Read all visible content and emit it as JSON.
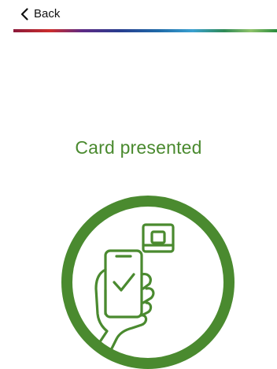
{
  "header": {
    "back_label": "Back",
    "back_icon": "chevron-left-icon"
  },
  "brand_strip": {
    "colors": [
      "#8c1a3a",
      "#cc2d2d",
      "#5e2a84",
      "#283c8e",
      "#1f6aa8",
      "#3aa0d0",
      "#2f8a56",
      "#8fc36b",
      "#2a8b3d"
    ]
  },
  "status": {
    "message": "Card presented",
    "color": "#4a8a2f",
    "icon": "hand-phone-card-check-icon"
  }
}
